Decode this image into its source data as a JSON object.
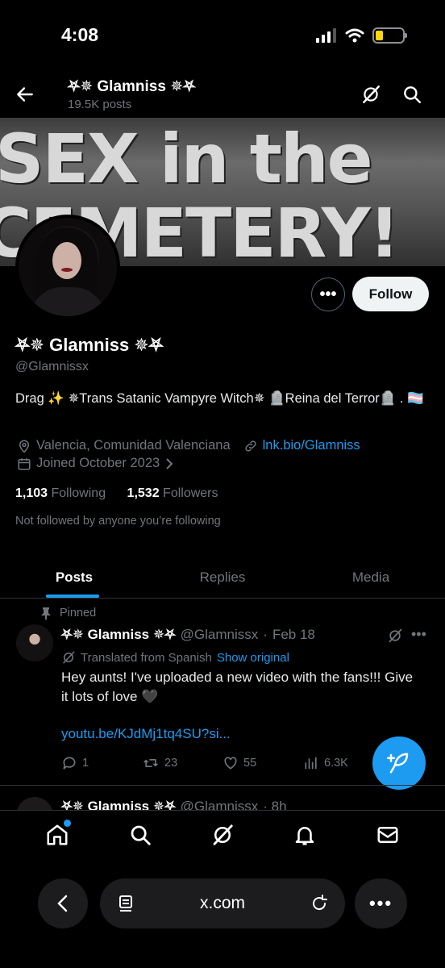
{
  "status": {
    "time": "4:08"
  },
  "header": {
    "title": "⛧✵ Glamniss ✵⛧",
    "posts": "19.5K posts"
  },
  "banner": {
    "line1": "SEX in the",
    "line2": "CEMETERY!"
  },
  "profile": {
    "more_label": "•••",
    "follow_label": "Follow",
    "name": "⛧✵ Glamniss ✵⛧",
    "handle": "@Glamnissx",
    "bio": "Drag ✨  ✵Trans Satanic Vampyre Witch✵ 🪦Reina del Terror🪦 . 🏳️‍⚧️",
    "location": "Valencia, Comunidad Valenciana",
    "link": "lnk.bio/Glamniss",
    "joined": "Joined October 2023",
    "following_count": "1,103",
    "following_label": "Following",
    "followers_count": "1,532",
    "followers_label": "Followers",
    "not_followed": "Not followed by anyone you’re following"
  },
  "tabs": [
    {
      "label": "Posts"
    },
    {
      "label": "Replies"
    },
    {
      "label": "Media"
    }
  ],
  "tweet": {
    "pinned_label": "Pinned",
    "name": "⛧✵ Glamniss ✵⛧",
    "handle": "@Glamnissx",
    "dot": "·",
    "date": "Feb 18",
    "more": "•••",
    "translated": "Translated from Spanish",
    "show_original": "Show original",
    "text": "Hey aunts! I've uploaded a new video with the fans!!! Give it lots of love 🖤",
    "link": "youtu.be/KJdMj1tq4SU?si...",
    "replies": "1",
    "reposts": "23",
    "likes": "55",
    "views": "6.3K"
  },
  "tweet2": {
    "name": "⛧✵ Glamniss ✵⛧",
    "handle": "@Glamnissx",
    "time": "· 8h"
  },
  "browser": {
    "url": "x.com",
    "more": "•••"
  },
  "colors": {
    "accent": "#1d9bf0",
    "muted": "#71767b",
    "background": "#000000"
  }
}
